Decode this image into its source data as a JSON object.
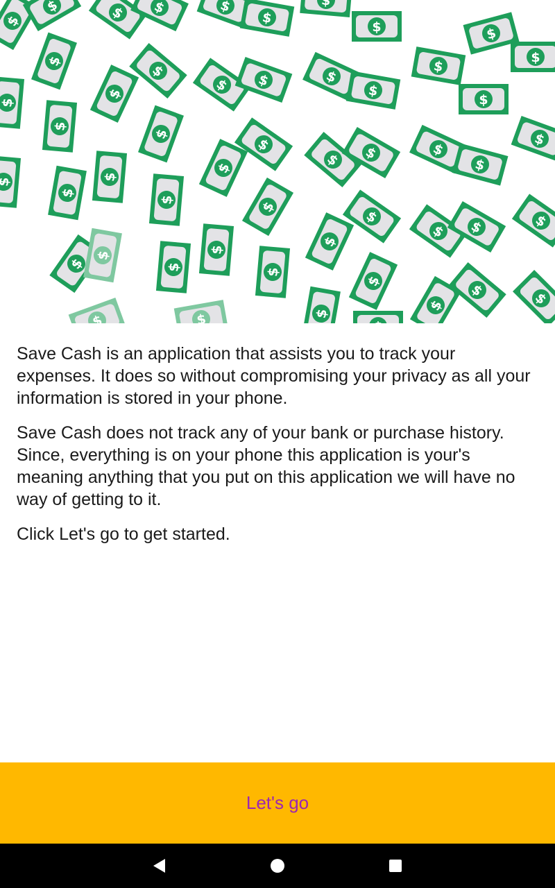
{
  "hero": {
    "illustration": "falling-money-bills",
    "bill_symbol": "$",
    "colors": {
      "bill_green": "#1E9E5A",
      "bill_light": "#7FC8A0",
      "bill_fill": "#E3E3E6"
    }
  },
  "intro": {
    "paragraphs": [
      "Save Cash is an application that assists you to track your expenses. It does so without compromising your privacy as all your information is stored in your phone.",
      "Save Cash does not track any of your bank or purchase history. Since, everything is on your phone this application is your's meaning anything that you put on this application we will have no way of getting to it.",
      "Click Let's go to get started."
    ]
  },
  "cta": {
    "label": "Let's go",
    "background": "#FFB800",
    "text_color": "#9C27B0"
  },
  "navbar": {
    "back_icon": "back-triangle-icon",
    "home_icon": "home-circle-icon",
    "recents_icon": "recents-square-icon"
  }
}
